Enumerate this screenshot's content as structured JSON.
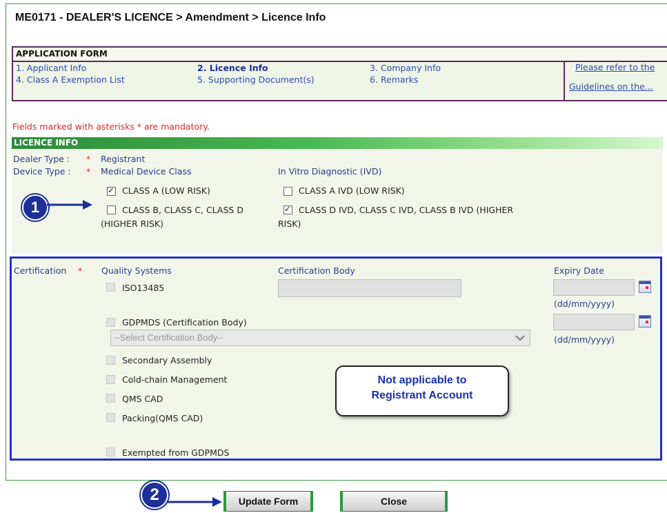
{
  "page": {
    "title": "ME0171 - DEALER'S LICENCE > Amendment > Licence Info"
  },
  "application_form": {
    "header": "APPLICATION FORM",
    "steps": [
      {
        "label": "1. Applicant Info",
        "active": false
      },
      {
        "label": "2. Licence Info",
        "active": true
      },
      {
        "label": "3. Company Info",
        "active": false
      },
      {
        "label": "4. Class A Exemption List",
        "active": false
      },
      {
        "label": "5. Supporting Document(s)",
        "active": false
      },
      {
        "label": "6. Remarks",
        "active": false
      }
    ],
    "guideline_link_1": "Please refer to the",
    "guideline_link_2": "Guidelines on the..."
  },
  "mandatory_note": "Fields marked with asterisks * are mandatory.",
  "licence_info": {
    "header": "LICENCE INFO",
    "dealer_type_label": "Dealer Type :",
    "dealer_type_value": "Registrant",
    "device_type_label": "Device Type :",
    "required_mark": "*",
    "medical_device_class_label": "Medical Device Class",
    "ivd_label": "In Vitro Diagnostic (IVD)",
    "class_a": {
      "label": "CLASS A (LOW RISK)",
      "checked": true
    },
    "class_bcd_line1": "CLASS B, CLASS C, CLASS D",
    "class_bcd_line2": "(HIGHER RISK)",
    "class_bcd_checked": false,
    "class_a_ivd": {
      "label": "CLASS A IVD (LOW RISK)",
      "checked": false
    },
    "class_dcb_ivd_line1": "CLASS D IVD, CLASS C IVD, CLASS B IVD (HIGHER",
    "class_dcb_ivd_line2": "RISK)",
    "class_dcb_ivd_checked": true
  },
  "certification": {
    "label": "Certification",
    "required_mark": "*",
    "quality_systems_header": "Quality Systems",
    "cert_body_header": "Certification Body",
    "expiry_header": "Expiry Date",
    "date_format_1": "(dd/mm/yyyy)",
    "date_format_2": "(dd/mm/yyyy)",
    "iso13485": "ISO13485",
    "gdpmds": "GDPMDS (Certification Body)",
    "select_placeholder": "--Select Certification Body--",
    "secondary_assembly": "Secondary Assembly",
    "cold_chain": "Cold-chain Management",
    "qms_cad": "QMS CAD",
    "packing": "Packing(QMS CAD)",
    "exempted": "Exempted from GDPMDS"
  },
  "annotations": {
    "marker_1": "1",
    "marker_2": "2",
    "callout_line1": "Not applicable to",
    "callout_line2": "Registrant Account",
    "arrow_color": "#1c2f9a"
  },
  "buttons": {
    "update_form": "Update Form",
    "close": "Close"
  },
  "colors": {
    "accent_green": "#2d9a3c",
    "frame_purple": "#5a2a5a",
    "highlight_blue": "#2233cc",
    "required_red": "#e02424"
  }
}
